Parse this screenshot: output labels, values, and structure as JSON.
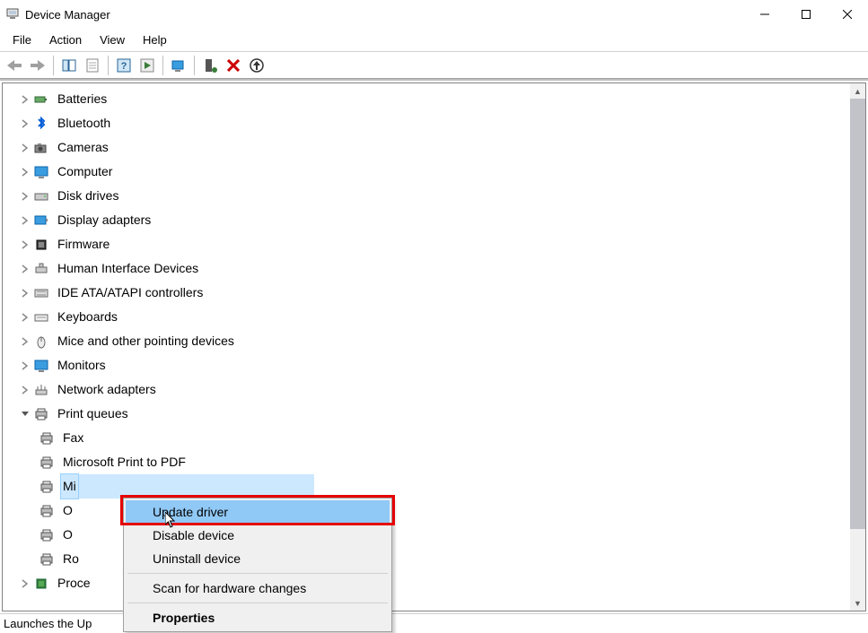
{
  "window": {
    "title": "Device Manager"
  },
  "menus": {
    "file": "File",
    "action": "Action",
    "view": "View",
    "help": "Help"
  },
  "tree": {
    "items": [
      {
        "label": "Batteries",
        "icon": "battery-icon",
        "expanded": false
      },
      {
        "label": "Bluetooth",
        "icon": "bluetooth-icon",
        "expanded": false
      },
      {
        "label": "Cameras",
        "icon": "camera-icon",
        "expanded": false
      },
      {
        "label": "Computer",
        "icon": "monitor-icon",
        "expanded": false
      },
      {
        "label": "Disk drives",
        "icon": "disk-icon",
        "expanded": false
      },
      {
        "label": "Display adapters",
        "icon": "display-adapter-icon",
        "expanded": false
      },
      {
        "label": "Firmware",
        "icon": "firmware-icon",
        "expanded": false
      },
      {
        "label": "Human Interface Devices",
        "icon": "hid-icon",
        "expanded": false
      },
      {
        "label": "IDE ATA/ATAPI controllers",
        "icon": "ide-icon",
        "expanded": false
      },
      {
        "label": "Keyboards",
        "icon": "keyboard-icon",
        "expanded": false
      },
      {
        "label": "Mice and other pointing devices",
        "icon": "mouse-icon",
        "expanded": false
      },
      {
        "label": "Monitors",
        "icon": "monitor-icon",
        "expanded": false
      },
      {
        "label": "Network adapters",
        "icon": "network-icon",
        "expanded": false
      },
      {
        "label": "Print queues",
        "icon": "printer-icon",
        "expanded": true,
        "children": [
          {
            "label": "Fax",
            "icon": "printer-icon"
          },
          {
            "label": "Microsoft Print to PDF",
            "icon": "printer-icon"
          },
          {
            "label": "Mi",
            "icon": "printer-icon",
            "selected": true
          },
          {
            "label": "O",
            "icon": "printer-icon"
          },
          {
            "label": "O",
            "icon": "printer-icon"
          },
          {
            "label": "Ro",
            "icon": "printer-icon"
          }
        ]
      },
      {
        "label": "Proce",
        "icon": "processor-icon",
        "expanded": false
      }
    ]
  },
  "context_menu": {
    "items": [
      {
        "label": "Update driver",
        "highlighted": true
      },
      {
        "label": "Disable device"
      },
      {
        "label": "Uninstall device"
      }
    ],
    "items2": [
      {
        "label": "Scan for hardware changes"
      }
    ],
    "items3": [
      {
        "label": "Properties",
        "bold": true
      }
    ]
  },
  "statusbar": {
    "text": "Launches the Up"
  }
}
